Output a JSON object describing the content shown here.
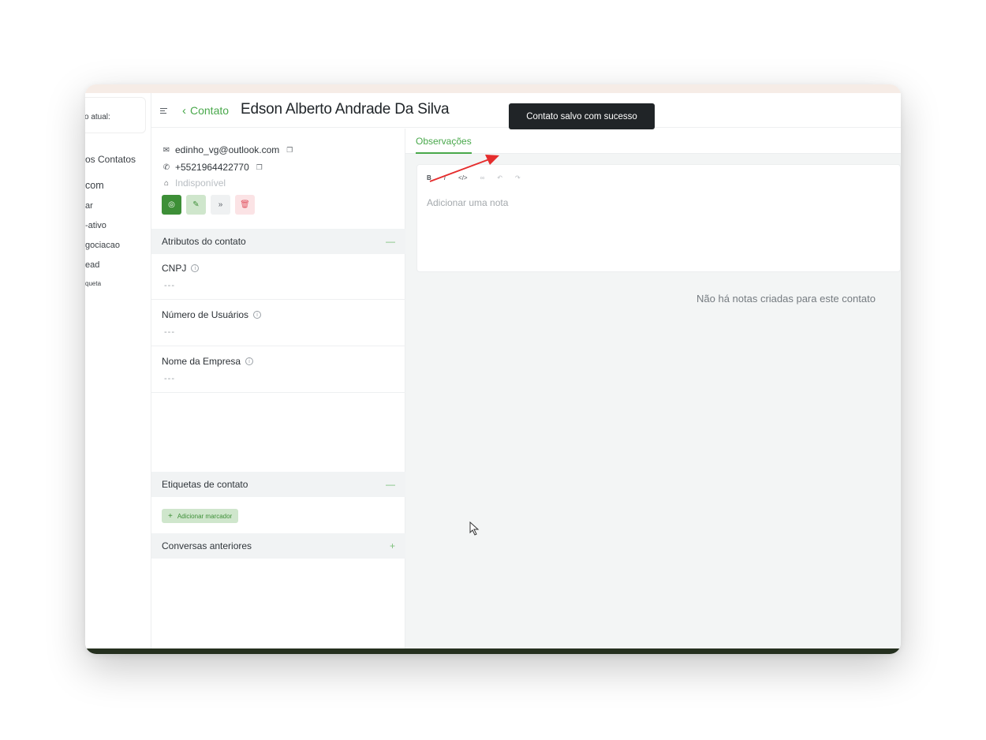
{
  "colors": {
    "accent": "#49a84b",
    "toast_bg": "#202427",
    "annotation_arrow": "#e52d2d"
  },
  "left_nav": {
    "top_box_text": "o atual:",
    "items": [
      "os Contatos",
      "com",
      "ar",
      "-ativo",
      "gociacao",
      "ead",
      "queta"
    ]
  },
  "header": {
    "menu_icon": "menu-icon",
    "back_label": "Contato",
    "title": "Edson Alberto Andrade Da Silva"
  },
  "toast": {
    "message": "Contato salvo com sucesso"
  },
  "contact": {
    "email": "edinho_vg@outlook.com",
    "phone": "+5521964422770",
    "company": "Indisponível",
    "actions": [
      "chat-icon",
      "pencil-icon",
      "merge-icon",
      "trash-icon"
    ]
  },
  "attributes": {
    "title": "Atributos do contato",
    "items": [
      {
        "label": "CNPJ",
        "value": "---"
      },
      {
        "label": "Número de Usuários",
        "value": "---"
      },
      {
        "label": "Nome da Empresa",
        "value": "---"
      }
    ]
  },
  "labels": {
    "title": "Etiquetas de contato",
    "add_button": "Adicionar marcador"
  },
  "previous_conversations": {
    "title": "Conversas anteriores"
  },
  "notes": {
    "tab": "Observações",
    "toolbar": [
      "B",
      "I",
      "</>",
      "link",
      "undo",
      "redo"
    ],
    "placeholder": "Adicionar uma nota",
    "empty_message": "Não há notas criadas para este contato"
  }
}
